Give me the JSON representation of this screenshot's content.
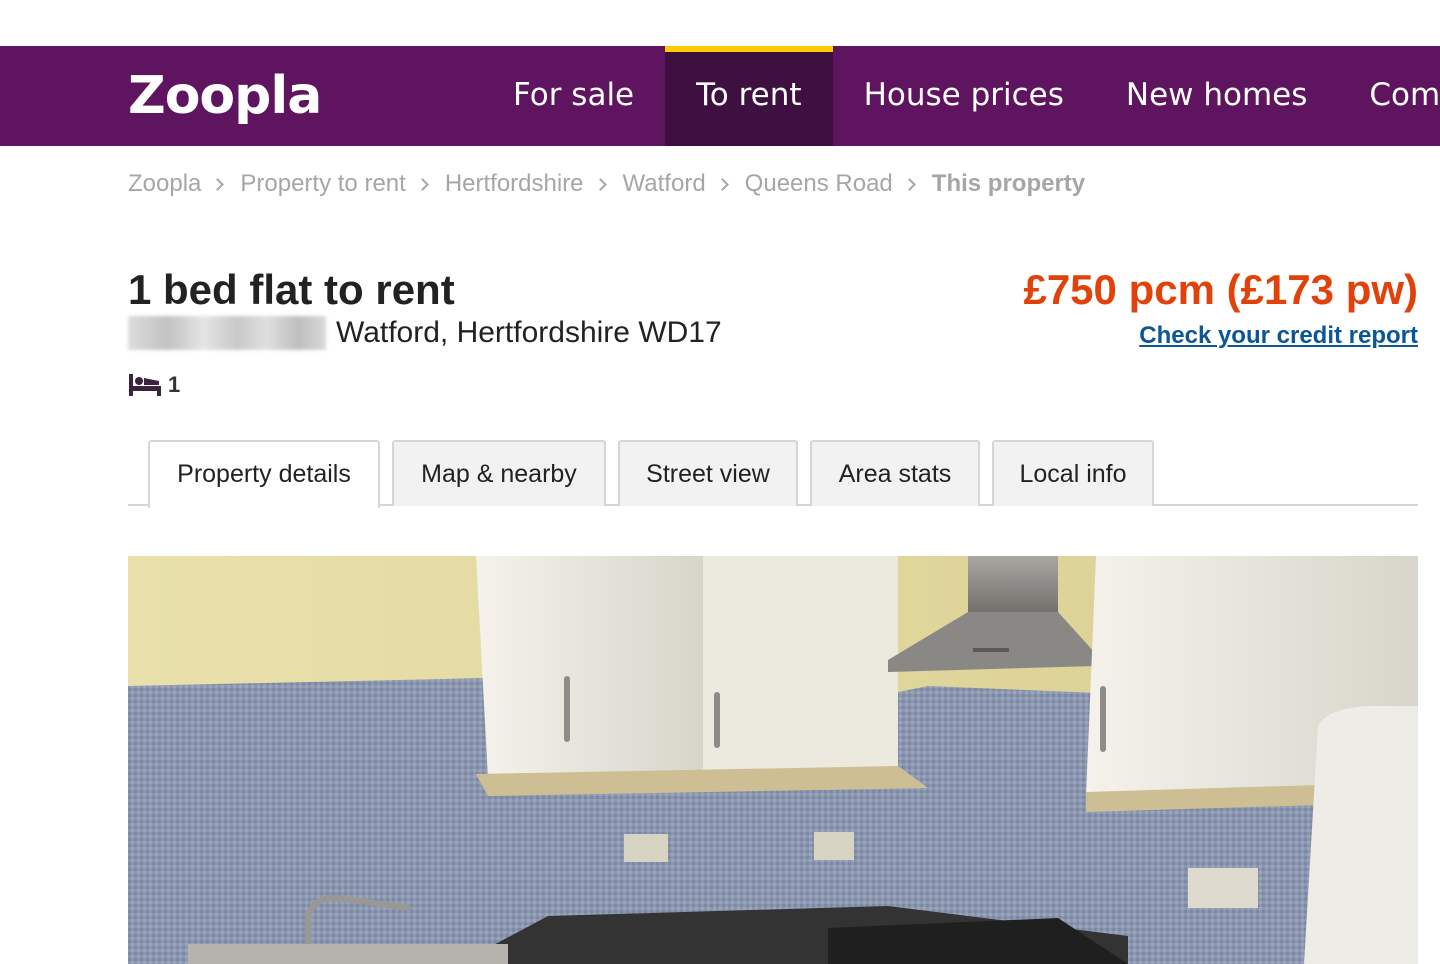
{
  "header": {
    "logo_text": "Zoopla",
    "nav": [
      {
        "label": "For sale",
        "active": false
      },
      {
        "label": "To rent",
        "active": true
      },
      {
        "label": "House prices",
        "active": false
      },
      {
        "label": "New homes",
        "active": false
      },
      {
        "label": "Comme",
        "active": false
      }
    ],
    "brand_color": "#5e145e",
    "active_accent": "#ffcb05"
  },
  "breadcrumb": [
    "Zoopla",
    "Property to rent",
    "Hertfordshire",
    "Watford",
    "Queens Road",
    "This property"
  ],
  "listing": {
    "title": "1 bed flat to rent",
    "address": "Watford, Hertfordshire WD17",
    "bedrooms": "1",
    "bed_icon": "bed-icon",
    "price": "£750 pcm (£173 pw)",
    "price_color": "#e1420c",
    "credit_link": "Check your credit report"
  },
  "tabs": [
    {
      "label": "Property details",
      "active": true
    },
    {
      "label": "Map & nearby",
      "active": false
    },
    {
      "label": "Street view",
      "active": false
    },
    {
      "label": "Area stats",
      "active": false
    },
    {
      "label": "Local info",
      "active": false
    }
  ]
}
